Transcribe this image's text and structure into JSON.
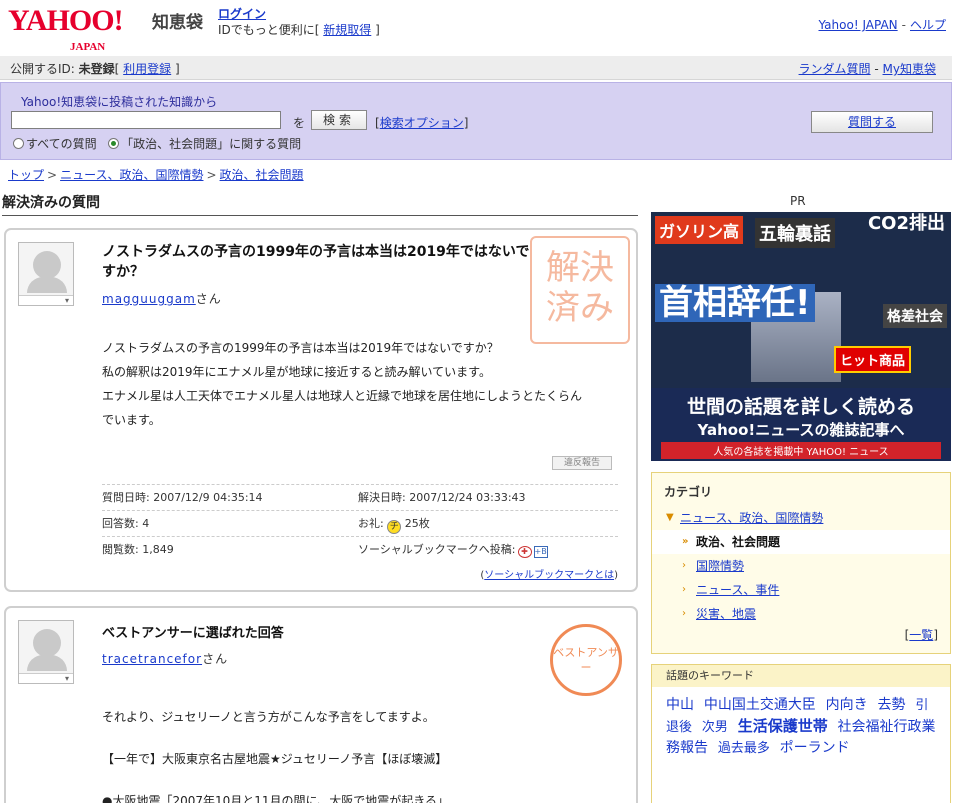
{
  "header": {
    "logo": "YAHOO!",
    "logo_sub": "JAPAN",
    "service": "知恵袋",
    "login": "ログイン",
    "login_note": "IDでもっと便利に",
    "signup": "新規取得",
    "top_links": [
      "Yahoo! JAPAN",
      "ヘルプ"
    ]
  },
  "idbar": {
    "public_id_label": "公開するID:",
    "status": "未登録",
    "register": "利用登録",
    "random": "ランダム質問",
    "my": "My知恵袋"
  },
  "search": {
    "intro": "Yahoo!知恵袋に投稿された知識から",
    "value": "",
    "wo": "を",
    "button": "検索",
    "options": "検索オプション",
    "radio_all": "すべての質問",
    "radio_cat": "「政治、社会問題」に関する質問",
    "ask": "質問する"
  },
  "breadcrumb": [
    "トップ",
    "ニュース、政治、国際情勢",
    "政治、社会問題"
  ],
  "section_title": "解決済みの質問",
  "question": {
    "title": "ノストラダムスの予言の1999年の予言は本当は2019年ではないですか？",
    "user": "magguuggam",
    "san": "さん",
    "stamp": "解決済み",
    "body": [
      "ノストラダムスの予言の1999年の予言は本当は2019年ではないですか？",
      "私の解釈は2019年にエナメル星が地球に接近すると読み解いています。",
      "エナメル星は人工天体でエナメル星人は地球人と近縁で地球を居住地にしようとたくらん",
      "でいます。"
    ],
    "report": "違反報告",
    "asked_label": "質問日時:",
    "asked": "2007/12/9 04:35:14",
    "solved_label": "解決日時:",
    "solved": "2007/12/24 03:33:43",
    "answers_label": "回答数:",
    "answers": "4",
    "reward_label": "お礼:",
    "reward": "25枚",
    "views_label": "閲覧数:",
    "views": "1,849",
    "social_label": "ソーシャルブックマークへ投稿:",
    "social_link": "ソーシャルブックマークとは"
  },
  "answer": {
    "title": "ベストアンサーに選ばれた回答",
    "user": "tracetrancefor",
    "san": "さん",
    "stamp": "ベストアンサー",
    "body": [
      "それより、ジュセリーノと言う方がこんな予言をしてますよ。",
      "【一年で】大阪東京名古屋地震★ジュセリーノ予言【ほぼ壊滅】",
      "●大阪地震「2007年10月と11月の間に、大阪で地震が起きる」"
    ]
  },
  "sidebar": {
    "pr": "PR",
    "ad": {
      "t1": "ガソリン高",
      "t2": "五輪裏話",
      "t3": "CO2排出",
      "t4": "首相辞任!",
      "t5": "格差社会",
      "t6": "ヒット商品",
      "l1": "世間の話題を詳しく読める",
      "l2": "Yahoo!ニュースの雑誌記事へ",
      "l3": "人気の各誌を掲載中 YAHOO! ニュース"
    },
    "category": {
      "head": "カテゴリ",
      "parent": "ニュース、政治、国際情勢",
      "current": "政治、社会問題",
      "children": [
        "国際情勢",
        "ニュース、事件",
        "災害、地震"
      ],
      "more": "一覧"
    },
    "keywords": {
      "head": "話題のキーワード",
      "words": [
        {
          "t": "中山",
          "s": "m"
        },
        {
          "t": "中山国土交通大臣",
          "s": "m"
        },
        {
          "t": "内向き",
          "s": "m"
        },
        {
          "t": "去勢",
          "s": "m"
        },
        {
          "t": "引退後",
          "s": "s"
        },
        {
          "t": "次男",
          "s": "s"
        },
        {
          "t": "生活保護世帯",
          "s": "l"
        },
        {
          "t": "社会福祉行政業務報告",
          "s": "m"
        },
        {
          "t": "過去最多",
          "s": "s"
        },
        {
          "t": "ポーランド",
          "s": "m"
        }
      ]
    }
  }
}
